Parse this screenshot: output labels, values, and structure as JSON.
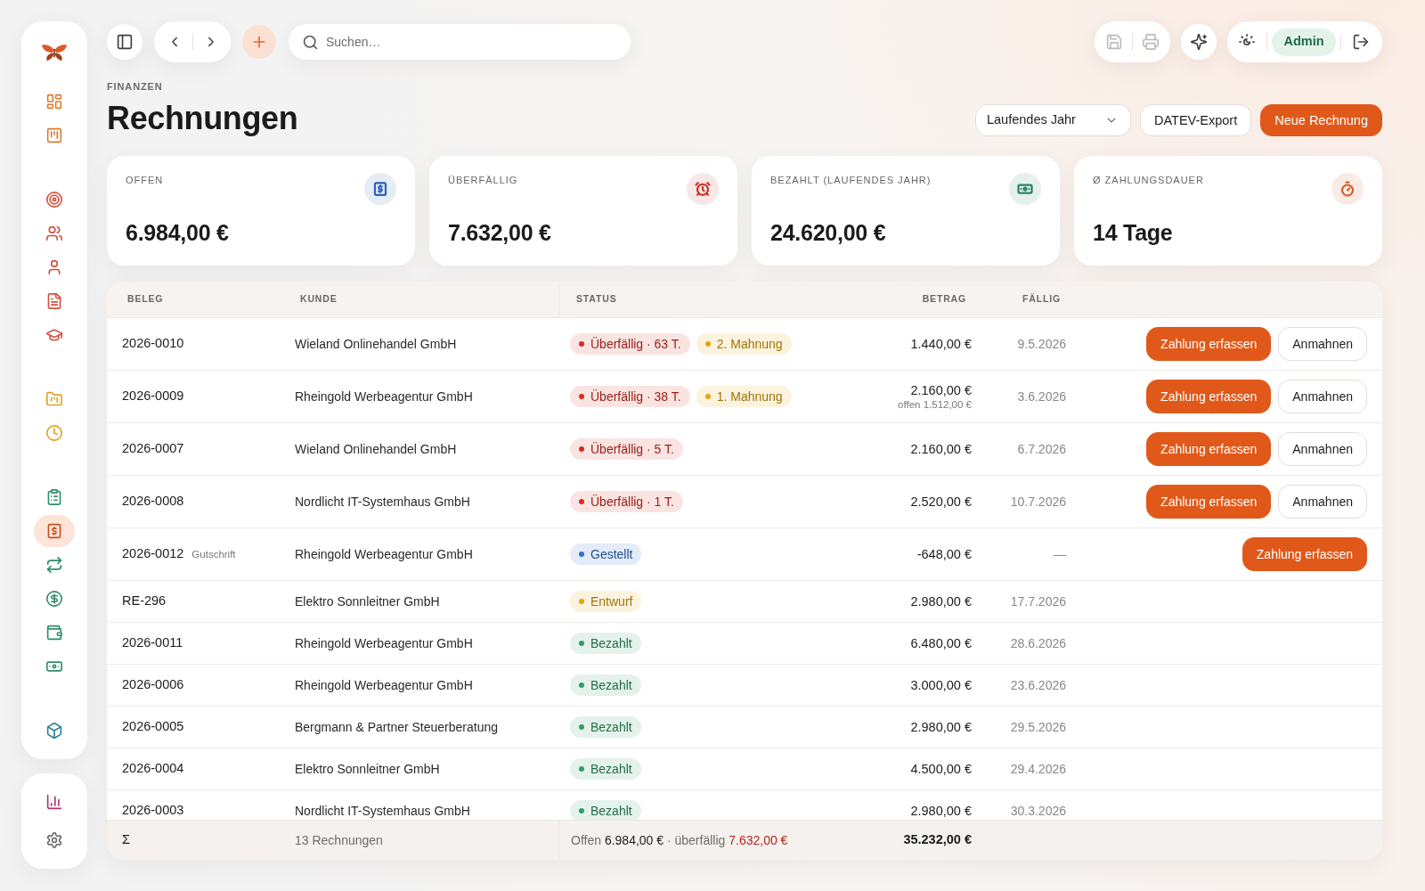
{
  "sidebar": {
    "groups": [
      {
        "items": [
          {
            "selected": false,
            "color": "#e07a2c"
          },
          {
            "selected": false,
            "color": "#e07a2c"
          }
        ]
      },
      {
        "items": [
          {
            "selected": false,
            "color": "#d4503e"
          },
          {
            "selected": false,
            "color": "#d4503e"
          },
          {
            "selected": false,
            "color": "#d4503e"
          },
          {
            "selected": false,
            "color": "#d4503e"
          },
          {
            "selected": false,
            "color": "#d4503e"
          }
        ]
      },
      {
        "items": [
          {
            "selected": false,
            "color": "#dea21f"
          },
          {
            "selected": false,
            "color": "#dea21f"
          }
        ]
      },
      {
        "items": [
          {
            "selected": false,
            "color": "#2f8c6c"
          },
          {
            "selected": true,
            "color": "#c4511f"
          },
          {
            "selected": false,
            "color": "#2f8c6c"
          },
          {
            "selected": false,
            "color": "#2f8c6c"
          },
          {
            "selected": false,
            "color": "#2f8c6c"
          },
          {
            "selected": false,
            "color": "#2f8c6c"
          }
        ]
      },
      {
        "items": [
          {
            "selected": false,
            "color": "#2f7d93"
          }
        ]
      }
    ],
    "bottom_items": [
      {
        "selected": false,
        "color": "#b0346c"
      },
      {
        "selected": false,
        "color": "#6b6b6b"
      }
    ]
  },
  "top_bar": {
    "search": {
      "placeholder": "Suchen…"
    },
    "file_actions": [
      {
        "disabled": true
      },
      {
        "disabled": true
      }
    ],
    "user": "Admin"
  },
  "page": {
    "breadcrumb": "FINANZEN",
    "title": "Rechnungen",
    "period": {
      "value": "Laufendes Jahr"
    },
    "actions": [
      {
        "label": "DATEV-Export",
        "kind": "secondary"
      },
      {
        "label": "Neue Rechnung",
        "kind": "primary"
      }
    ]
  },
  "stats": [
    {
      "label": "OFFEN",
      "value": "6.984,00 €",
      "color": "#2f62b5"
    },
    {
      "label": "ÜBERFÄLLIG",
      "value": "7.632,00 €",
      "color": "#c8372d"
    },
    {
      "label": "BEZAHLT (LAUFENDES JAHR)",
      "value": "24.620,00 €",
      "color": "#2a8560"
    },
    {
      "label": "Ø ZAHLUNGSDAUER",
      "value": "14 Tage",
      "color": "#d8612a"
    }
  ],
  "table": {
    "columns": [
      "BELEG",
      "KUNDE",
      "STATUS",
      "BETRAG",
      "FÄLLIG"
    ],
    "rows": [
      {
        "id": "2026-0010",
        "customer": "Wieland Onlinehandel GmbH",
        "status": [
          {
            "label": "Überfällig · 63 T.",
            "color": "#d92d20"
          },
          {
            "label": "2. Mahnung",
            "color": "#e5a50a"
          }
        ],
        "amount": "1.440,00 €",
        "due": "9.5.2026",
        "actions": [
          {
            "label": "Zahlung erfassen",
            "kind": "primary"
          },
          {
            "label": "Anmahnen",
            "kind": "secondary"
          }
        ]
      },
      {
        "id": "2026-0009",
        "customer": "Rheingold Werbeagentur GmbH",
        "status": [
          {
            "label": "Überfällig · 38 T.",
            "color": "#d92d20"
          },
          {
            "label": "1. Mahnung",
            "color": "#e5a50a"
          }
        ],
        "amount": "2.160,00 €",
        "amount_note": "offen 1.512,00 €",
        "due": "3.6.2026",
        "actions": [
          {
            "label": "Zahlung erfassen",
            "kind": "primary"
          },
          {
            "label": "Anmahnen",
            "kind": "secondary"
          }
        ]
      },
      {
        "id": "2026-0007",
        "customer": "Wieland Onlinehandel GmbH",
        "status": [
          {
            "label": "Überfällig · 5 T.",
            "color": "#d92d20"
          }
        ],
        "amount": "2.160,00 €",
        "due": "6.7.2026",
        "actions": [
          {
            "label": "Zahlung erfassen",
            "kind": "primary"
          },
          {
            "label": "Anmahnen",
            "kind": "secondary"
          }
        ]
      },
      {
        "id": "2026-0008",
        "customer": "Nordlicht IT-Systemhaus GmbH",
        "status": [
          {
            "label": "Überfällig · 1 T.",
            "color": "#d92d20"
          }
        ],
        "amount": "2.520,00 €",
        "due": "10.7.2026",
        "actions": [
          {
            "label": "Zahlung erfassen",
            "kind": "primary"
          },
          {
            "label": "Anmahnen",
            "kind": "secondary"
          }
        ]
      },
      {
        "id": "2026-0012",
        "note": "Gutschrift",
        "customer": "Rheingold Werbeagentur GmbH",
        "status": [
          {
            "label": "Gestellt",
            "color": "#2f6fd0"
          }
        ],
        "amount": "-648,00 €",
        "due": "—",
        "actions": [
          {
            "label": "Zahlung erfassen",
            "kind": "primary"
          }
        ]
      },
      {
        "id": "RE-296",
        "customer": "Elektro Sonnleitner GmbH",
        "status": [
          {
            "label": "Entwurf",
            "color": "#e5a50a"
          }
        ],
        "amount": "2.980,00 €",
        "due": "17.7.2026"
      },
      {
        "id": "2026-0011",
        "customer": "Rheingold Werbeagentur GmbH",
        "status": [
          {
            "label": "Bezahlt",
            "color": "#2f9d66"
          }
        ],
        "amount": "6.480,00 €",
        "due": "28.6.2026"
      },
      {
        "id": "2026-0006",
        "customer": "Rheingold Werbeagentur GmbH",
        "status": [
          {
            "label": "Bezahlt",
            "color": "#2f9d66"
          }
        ],
        "amount": "3.000,00 €",
        "due": "23.6.2026"
      },
      {
        "id": "2026-0005",
        "customer": "Bergmann & Partner Steuerberatung",
        "status": [
          {
            "label": "Bezahlt",
            "color": "#2f9d66"
          }
        ],
        "amount": "2.980,00 €",
        "due": "29.5.2026"
      },
      {
        "id": "2026-0004",
        "customer": "Elektro Sonnleitner GmbH",
        "status": [
          {
            "label": "Bezahlt",
            "color": "#2f9d66"
          }
        ],
        "amount": "4.500,00 €",
        "due": "29.4.2026"
      },
      {
        "id": "2026-0003",
        "customer": "Nordlicht IT-Systemhaus GmbH",
        "status": [
          {
            "label": "Bezahlt",
            "color": "#2f9d66"
          }
        ],
        "amount": "2.980,00 €",
        "due": "30.3.2026"
      }
    ],
    "totals": {
      "symbol": "Σ",
      "count": "13 Rechnungen",
      "summary": [
        {
          "label": "Offen",
          "value": "6.984,00 €",
          "kind": "neutral"
        },
        {
          "label": "überfällig",
          "value": "7.632,00 €",
          "kind": "overdue"
        }
      ],
      "separator": "·",
      "total": "35.232,00 €"
    }
  }
}
